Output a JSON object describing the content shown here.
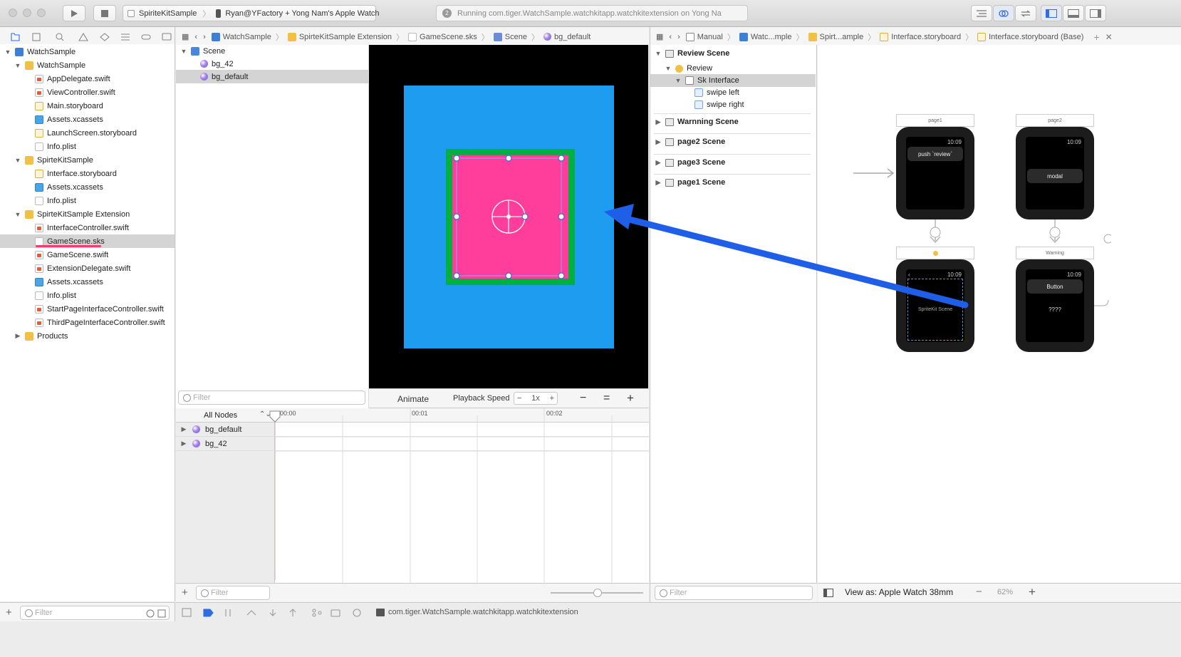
{
  "toolbar": {
    "scheme": "SpiriteKitSample",
    "destination": "Ryan@YFactory + Yong Nam's Apple Watch",
    "activity_badge": "2",
    "activity": "Running com.tiger.WatchSample.watchkitapp.watchkitextension on Yong Na"
  },
  "jump_bar": {
    "items": [
      "WatchSample",
      "SpirteKitSample Extension",
      "GameScene.sks",
      "Scene",
      "bg_default"
    ]
  },
  "assistant_jump_bar": {
    "items": [
      "Manual",
      "Watc...mple",
      "Spirt...ample",
      "Interface.storyboard",
      "Interface.storyboard (Base)"
    ]
  },
  "navigator": {
    "items": [
      {
        "label": "WatchSample",
        "level": 0,
        "kind": "proj",
        "disc": "▼"
      },
      {
        "label": "WatchSample",
        "level": 1,
        "kind": "folder",
        "disc": "▼"
      },
      {
        "label": "AppDelegate.swift",
        "level": 2,
        "kind": "swift"
      },
      {
        "label": "ViewController.swift",
        "level": 2,
        "kind": "swift"
      },
      {
        "label": "Main.storyboard",
        "level": 2,
        "kind": "sb"
      },
      {
        "label": "Assets.xcassets",
        "level": 2,
        "kind": "assets"
      },
      {
        "label": "LaunchScreen.storyboard",
        "level": 2,
        "kind": "sb"
      },
      {
        "label": "Info.plist",
        "level": 2,
        "kind": "plist"
      },
      {
        "label": "SpirteKitSample",
        "level": 1,
        "kind": "folder",
        "disc": "▼"
      },
      {
        "label": "Interface.storyboard",
        "level": 2,
        "kind": "sb"
      },
      {
        "label": "Assets.xcassets",
        "level": 2,
        "kind": "assets"
      },
      {
        "label": "Info.plist",
        "level": 2,
        "kind": "plist"
      },
      {
        "label": "SpirteKitSample Extension",
        "level": 1,
        "kind": "folder",
        "disc": "▼"
      },
      {
        "label": "InterfaceController.swift",
        "level": 2,
        "kind": "swift"
      },
      {
        "label": "GameScene.sks",
        "level": 2,
        "kind": "sks",
        "selected": true
      },
      {
        "label": "GameScene.swift",
        "level": 2,
        "kind": "swift"
      },
      {
        "label": "ExtensionDelegate.swift",
        "level": 2,
        "kind": "swift"
      },
      {
        "label": "Assets.xcassets",
        "level": 2,
        "kind": "assets"
      },
      {
        "label": "Info.plist",
        "level": 2,
        "kind": "plist"
      },
      {
        "label": "StartPageInterfaceController.swift",
        "level": 2,
        "kind": "swift"
      },
      {
        "label": "ThirdPageInterfaceController.swift",
        "level": 2,
        "kind": "swift"
      },
      {
        "label": "Products",
        "level": 1,
        "kind": "folder",
        "disc": "▶"
      }
    ],
    "filter_placeholder": "Filter"
  },
  "scene_outline": {
    "items": [
      {
        "label": "Scene",
        "kind": "scene"
      },
      {
        "label": "bg_42",
        "kind": "node"
      },
      {
        "label": "bg_default",
        "kind": "node",
        "selected": true
      }
    ],
    "filter_placeholder": "Filter"
  },
  "editor_bar": {
    "animate": "Animate",
    "playback_label": "Playback Speed",
    "speed_minus": "−",
    "speed": "1x",
    "speed_plus": "+",
    "zoom_out": "−",
    "zoom_fit": "=",
    "zoom_in": "+"
  },
  "timeline": {
    "filter_label": "All Nodes",
    "ticks": [
      "00:00",
      "00:01",
      "00:02"
    ],
    "rows": [
      "bg_default",
      "bg_42"
    ],
    "filter_placeholder": "Filter"
  },
  "ib_outline": {
    "items": [
      {
        "label": "Review Scene",
        "bold": true,
        "disc": "▼"
      },
      {
        "label": "Review",
        "disc": "▼"
      },
      {
        "label": "Sk Interface",
        "disc": "▼",
        "selected": true
      },
      {
        "label": "swipe left"
      },
      {
        "label": "swipe right"
      },
      {
        "label": "Warnning Scene",
        "bold": true,
        "disc": "▶"
      },
      {
        "label": "page2 Scene",
        "bold": true,
        "disc": "▶"
      },
      {
        "label": "page3 Scene",
        "bold": true,
        "disc": "▶"
      },
      {
        "label": "page1 Scene",
        "bold": true,
        "disc": "▶"
      }
    ],
    "filter_placeholder": "Filter"
  },
  "storyboard": {
    "watches": [
      {
        "title": "page1",
        "time": "10:09",
        "element": "push `review`"
      },
      {
        "title": "page2",
        "time": "10:09",
        "element": "modal"
      },
      {
        "title": "",
        "time": "10:09",
        "element": "SpriteKit Scene",
        "back": "‹"
      },
      {
        "title": "Warning",
        "time": "10:09",
        "element": "Button",
        "text": "????"
      }
    ],
    "view_as": "View as: Apple Watch 38mm",
    "zoom_minus": "−",
    "zoom": "62%",
    "zoom_plus": "+"
  },
  "status_bar": {
    "target": "com.tiger.WatchSample.watchkitapp.watchkitextension"
  },
  "colors": {
    "scene_bg": "#1e9cf0",
    "sprite_pink": "#ff3d9a",
    "sprite_border": "#00b140",
    "arrow": "#1f5fe8",
    "underline": "#f03c6e"
  }
}
